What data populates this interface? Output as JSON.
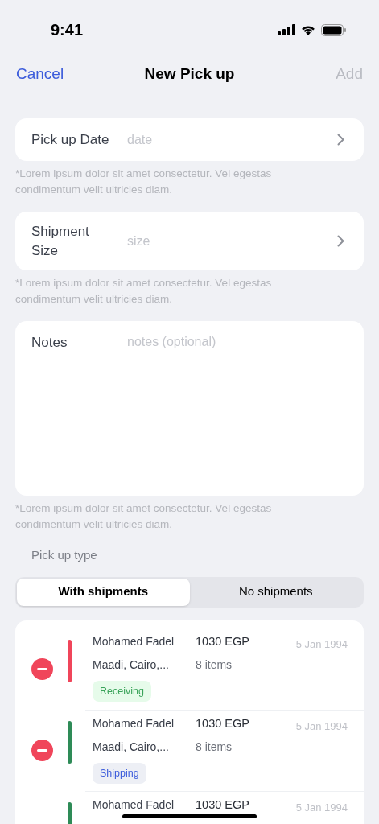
{
  "status_bar": {
    "time": "9:41"
  },
  "nav": {
    "cancel": "Cancel",
    "title": "New Pick up",
    "add": "Add",
    "add_disabled": true
  },
  "fields": [
    {
      "kind": "select",
      "label": "Pick up Date",
      "placeholder": "date",
      "helper": "*Lorem ipsum dolor sit amet consectetur. Vel egestas condimentum velit ultricies diam."
    },
    {
      "kind": "select",
      "label": "Shipment Size",
      "placeholder": "size",
      "helper": "*Lorem ipsum dolor sit amet consectetur. Vel egestas condimentum velit ultricies diam."
    },
    {
      "kind": "textarea",
      "label": "Notes",
      "placeholder": "notes (optional)",
      "helper": "*Lorem ipsum dolor sit amet consectetur. Vel egestas condimentum velit ultricies diam."
    }
  ],
  "pickup_type": {
    "label": "Pick up type",
    "options": [
      {
        "label": "With shipments",
        "selected": true
      },
      {
        "label": "No shipments",
        "selected": false
      }
    ]
  },
  "shipments": [
    {
      "removable": true,
      "color": "#f0455a",
      "name": "Mohamed Fadel",
      "amount": "1030 EGP",
      "date": "5 Jan 1994",
      "address": "Maadi, Cairo,...",
      "items": "8 items",
      "tag": {
        "kind": "receiving",
        "label": "Receiving"
      }
    },
    {
      "removable": true,
      "color": "#2e8b57",
      "name": "Mohamed Fadel",
      "amount": "1030 EGP",
      "date": "5 Jan 1994",
      "address": "Maadi, Cairo,...",
      "items": "8 items",
      "tag": {
        "kind": "shipping",
        "label": "Shipping"
      }
    },
    {
      "removable": false,
      "color": "#2e8b57",
      "name": "Mohamed Fadel",
      "amount": "1030 EGP",
      "date": "5 Jan 1994"
    }
  ]
}
